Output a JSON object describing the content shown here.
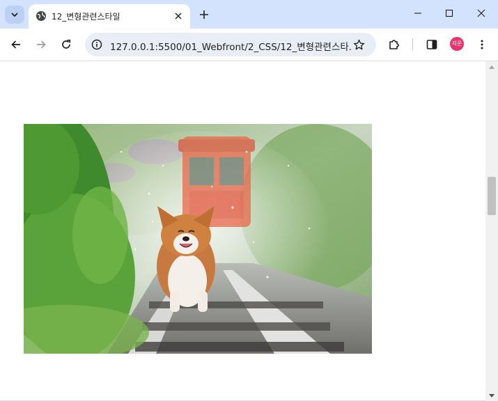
{
  "browser": {
    "tab": {
      "title": "12_변형관련스타일"
    },
    "address_bar": {
      "url": "127.0.0.1:5500/01_Webfront/2_CSS/12_변형관련스타..."
    },
    "profile": {
      "avatar_text": "지운",
      "color": "#e8336e"
    },
    "icons": {
      "tab_search": "chevron-down-icon",
      "favicon": "globe-icon",
      "tab_close": "close-icon",
      "new_tab": "plus-icon",
      "back": "back-arrow-icon",
      "forward": "forward-arrow-icon",
      "reload": "reload-icon",
      "site_info": "info-icon",
      "bookmark": "star-icon",
      "extensions": "puzzle-icon",
      "side_panel": "side-panel-icon",
      "menu": "more-vert-icon"
    },
    "colors": {
      "frame": "#d3e3fd",
      "omnibox": "#e9eef6"
    }
  },
  "page": {
    "image": {
      "subject": "corgi on railway tracks"
    }
  }
}
